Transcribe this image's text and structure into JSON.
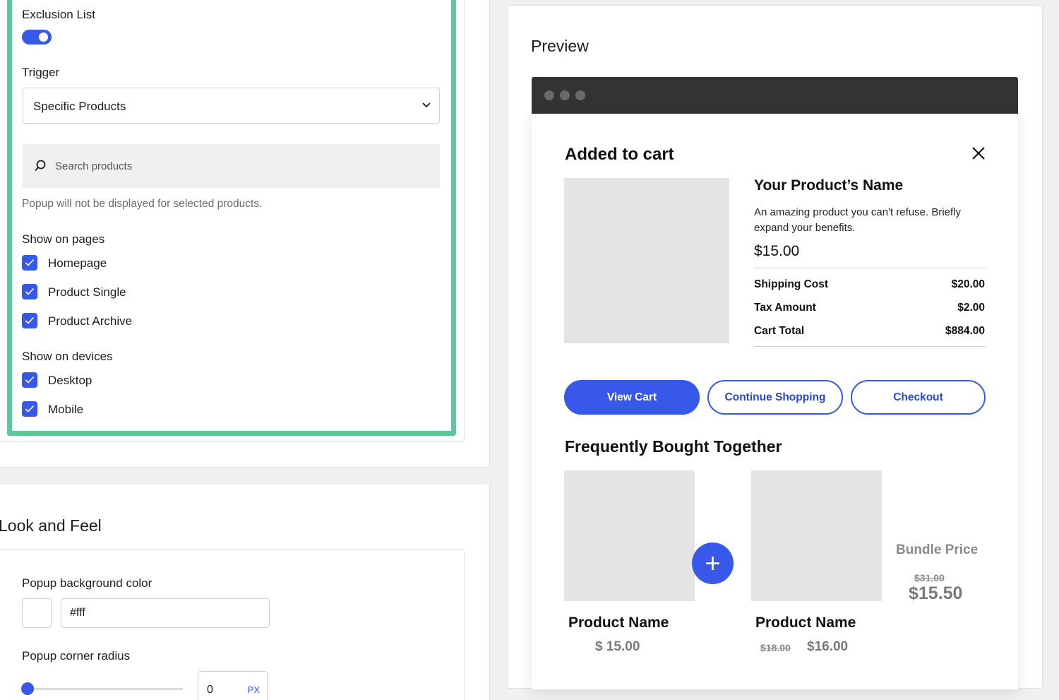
{
  "settings": {
    "exclusion_label": "Exclusion List",
    "exclusion_enabled": true,
    "trigger_label": "Trigger",
    "trigger_value": "Specific Products",
    "search_placeholder": "Search products",
    "help_text": "Popup will not be displayed for selected products.",
    "pages_label": "Show on pages",
    "pages": [
      {
        "label": "Homepage",
        "checked": true
      },
      {
        "label": "Product Single",
        "checked": true
      },
      {
        "label": "Product Archive",
        "checked": true
      }
    ],
    "devices_label": "Show on devices",
    "devices": [
      {
        "label": "Desktop",
        "checked": true
      },
      {
        "label": "Mobile",
        "checked": true
      }
    ]
  },
  "look_and_feel": {
    "title": "Look and Feel",
    "bg_color_label": "Popup background color",
    "bg_color_value": "#fff",
    "radius_label": "Popup corner radius",
    "radius_value": "0",
    "radius_unit": "PX"
  },
  "preview": {
    "title": "Preview",
    "popup": {
      "heading": "Added to cart",
      "product_name": "Your Product’s Name",
      "product_desc": "An amazing product you can't refuse. Briefly expand your benefits.",
      "product_price": "$15.00",
      "totals": [
        {
          "label": "Shipping Cost",
          "value": "$20.00"
        },
        {
          "label": "Tax Amount",
          "value": "$2.00"
        },
        {
          "label": "Cart Total",
          "value": "$884.00"
        }
      ],
      "buttons": {
        "view_cart": "View Cart",
        "continue_shopping": "Continue Shopping",
        "checkout": "Checkout"
      },
      "fbt": {
        "heading": "Frequently Bought Together",
        "items": [
          {
            "name": "Product Name",
            "price": "$ 15.00",
            "old_price": ""
          },
          {
            "name": "Product Name",
            "price": "$16.00",
            "old_price": "$18.00"
          }
        ],
        "bundle_label": "Bundle Price",
        "bundle_old": "$31.00",
        "bundle_new": "$15.50"
      }
    }
  },
  "colors": {
    "accent": "#3858e9",
    "highlight": "#5dc79a",
    "browser_bar": "#333333"
  }
}
